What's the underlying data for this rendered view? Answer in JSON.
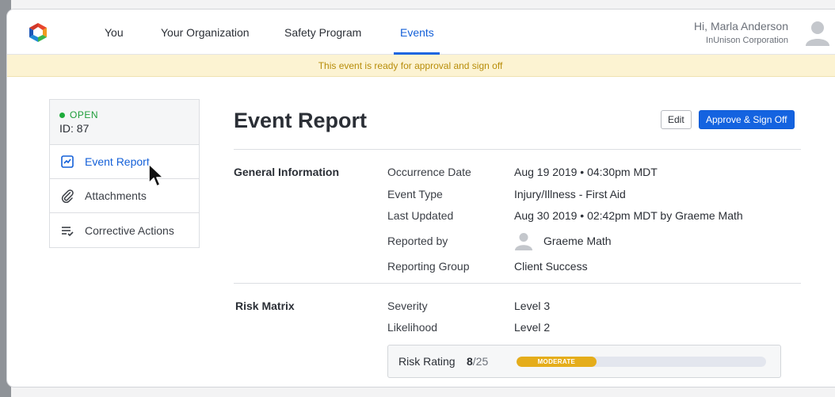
{
  "nav": {
    "items": [
      {
        "label": "You"
      },
      {
        "label": "Your Organization"
      },
      {
        "label": "Safety Program"
      },
      {
        "label": "Events"
      }
    ],
    "active_index": 3
  },
  "user": {
    "greeting": "Hi, Marla Anderson",
    "organization": "InUnison Corporation"
  },
  "banner": {
    "text": "This event is ready for approval and sign off",
    "color": "#b88d0a",
    "background": "#fcf3d2"
  },
  "sidebar": {
    "status": "OPEN",
    "status_color": "#1eab3b",
    "id_label": "ID: 87",
    "items": [
      {
        "label": "Event Report",
        "icon": "chart-icon",
        "active": true
      },
      {
        "label": "Attachments",
        "icon": "paperclip-icon",
        "active": false
      },
      {
        "label": "Corrective Actions",
        "icon": "checklist-icon",
        "active": false
      }
    ]
  },
  "main": {
    "title": "Event Report",
    "edit_label": "Edit",
    "approve_label": "Approve & Sign Off",
    "general": {
      "title": "General Information",
      "fields": [
        {
          "label": "Occurrence Date",
          "value": "Aug 19 2019 • 04:30pm MDT"
        },
        {
          "label": "Event Type",
          "value": "Injury/Illness - First Aid"
        },
        {
          "label": "Last Updated",
          "value": "Aug 30 2019 • 02:42pm MDT by Graeme Math"
        },
        {
          "label": "Reported by",
          "value": "Graeme Math"
        },
        {
          "label": "Reporting Group",
          "value": "Client Success"
        }
      ]
    },
    "risk": {
      "title": "Risk Matrix",
      "fields": [
        {
          "label": "Severity",
          "value": "Level 3"
        },
        {
          "label": "Likelihood",
          "value": "Level 2"
        }
      ],
      "rating_label": "Risk Rating",
      "score": "8",
      "score_max": "/25",
      "level": "MODERATE",
      "fill_fraction": 0.32,
      "fill_color": "#e5ad1b"
    }
  },
  "colors": {
    "accent": "#1463e0",
    "text": "#2b2f36"
  }
}
